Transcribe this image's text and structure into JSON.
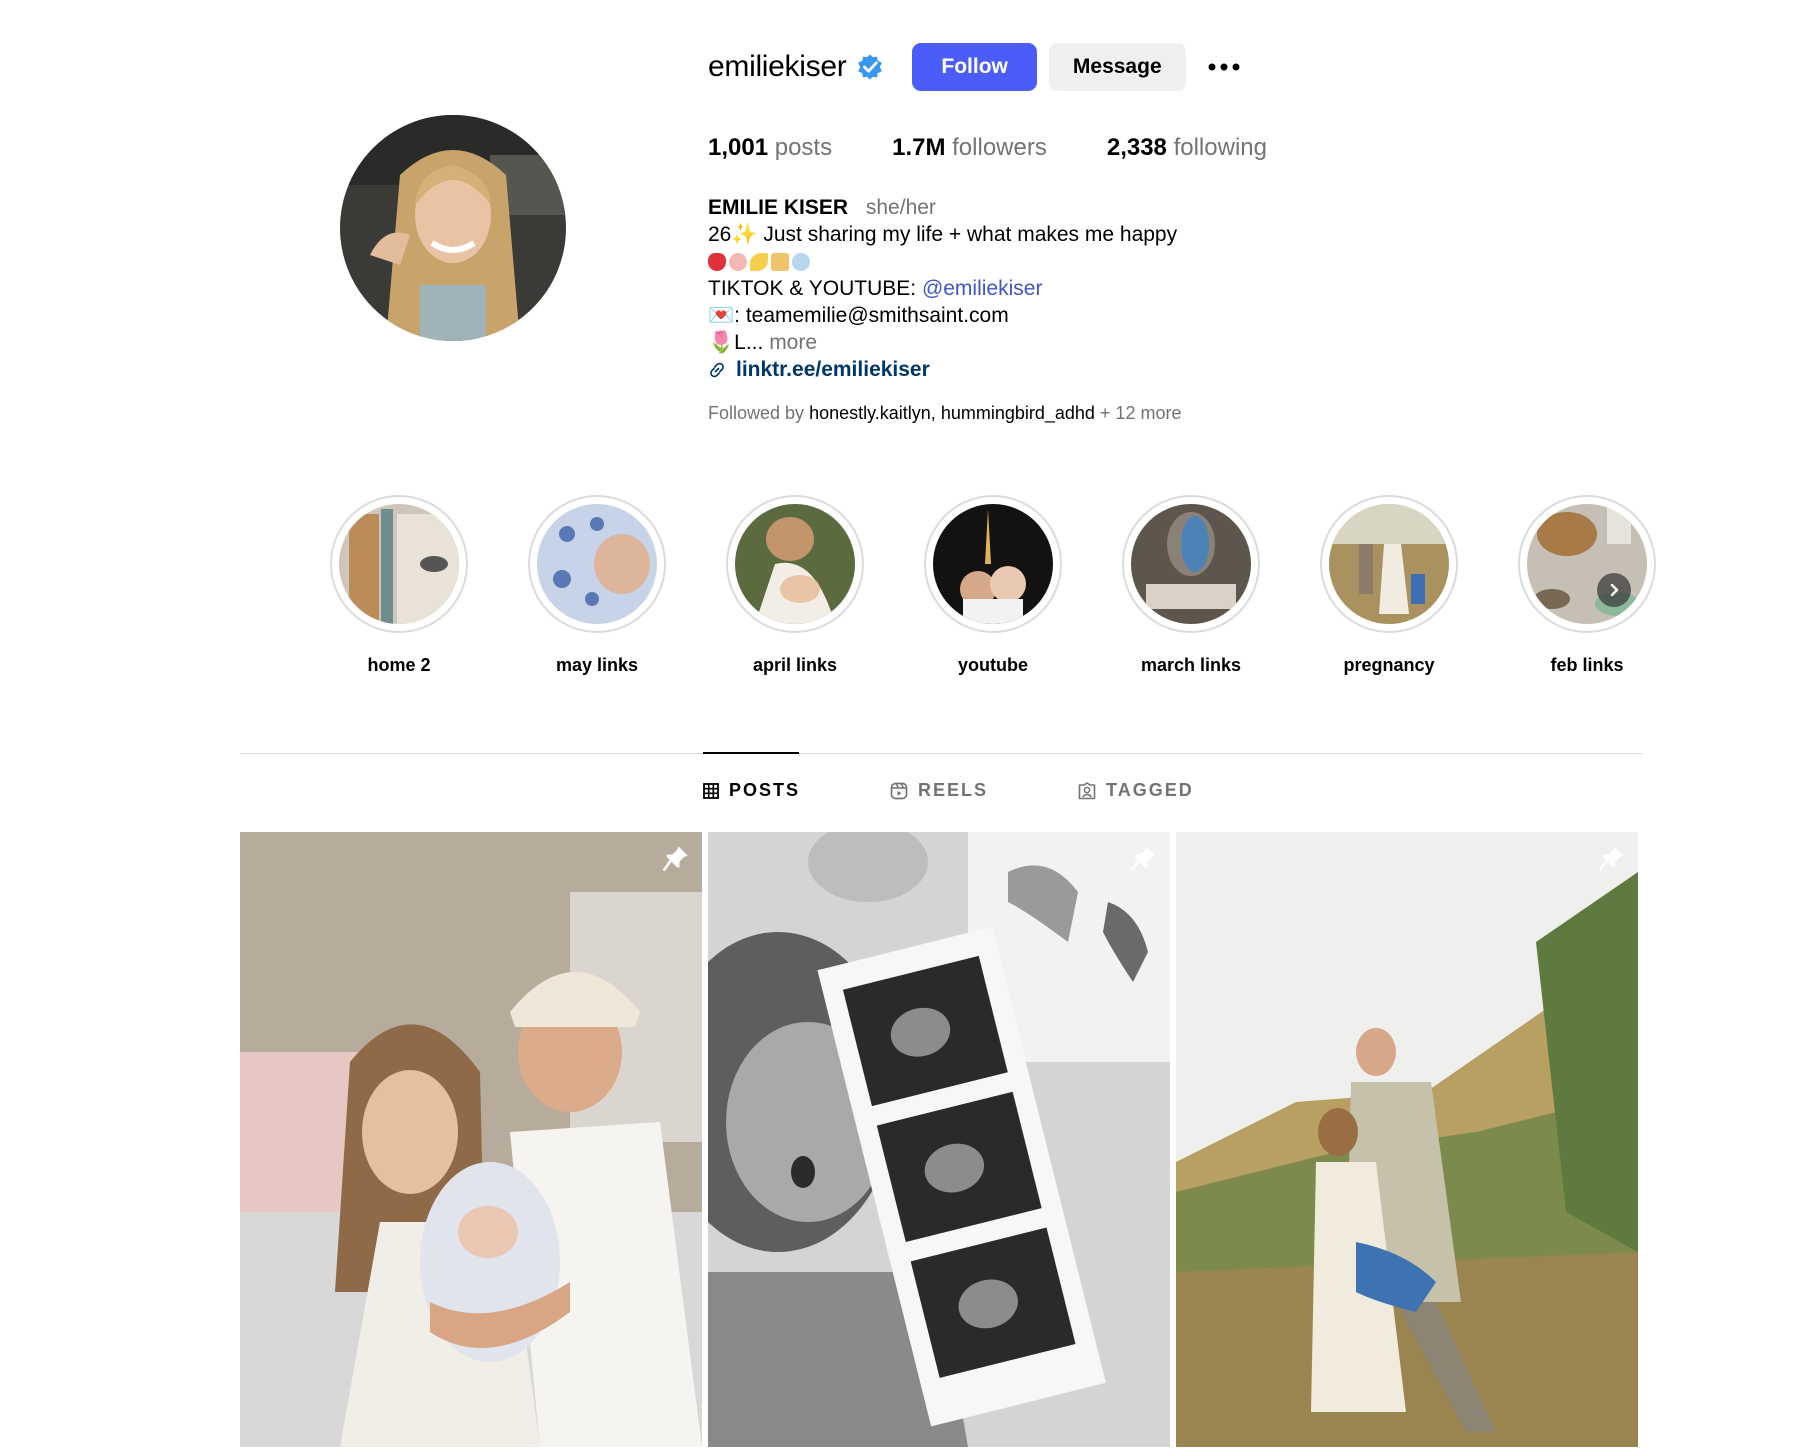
{
  "profile": {
    "username": "emiliekiser",
    "verified": true,
    "follow_label": "Follow",
    "message_label": "Message",
    "stats": {
      "posts_count": "1,001",
      "posts_label": "posts",
      "followers_count": "1.7M",
      "followers_label": "followers",
      "following_count": "2,338",
      "following_label": "following"
    },
    "bio": {
      "full_name": "EMILIE KISER",
      "pronouns": "she/her",
      "line1": "26✨ Just sharing my life + what makes me happy",
      "emoji_line": [
        "strawberry",
        "ballet-shoes",
        "banana",
        "cake",
        "fairy"
      ],
      "line3_prefix": "TIKTOK & YOUTUBE: ",
      "line3_mention": "@emiliekiser",
      "line4": "💌: teamemilie@smithsaint.com",
      "line5": "🌷L...",
      "more_label": "more",
      "link": "linktr.ee/emiliekiser"
    },
    "followed_by": {
      "prefix": "Followed by ",
      "user1": "honestly.kaitlyn",
      "separator": ", ",
      "user2": "hummingbird_adhd",
      "suffix": " + 12 more"
    }
  },
  "highlights": [
    {
      "label": "home 2"
    },
    {
      "label": "may links"
    },
    {
      "label": "april links"
    },
    {
      "label": "youtube"
    },
    {
      "label": "march links"
    },
    {
      "label": "pregnancy"
    },
    {
      "label": "feb links"
    }
  ],
  "tabs": [
    {
      "label": "POSTS",
      "active": true,
      "icon": "grid-icon"
    },
    {
      "label": "REELS",
      "active": false,
      "icon": "reels-icon"
    },
    {
      "label": "TAGGED",
      "active": false,
      "icon": "tagged-icon"
    }
  ],
  "posts": [
    {
      "pinned": true
    },
    {
      "pinned": true
    },
    {
      "pinned": true
    }
  ],
  "colors": {
    "follow_button": "#4a5df9",
    "verified_badge": "#3897f0",
    "mention": "#4056c6",
    "link": "#00376b",
    "muted_text": "#737373"
  }
}
